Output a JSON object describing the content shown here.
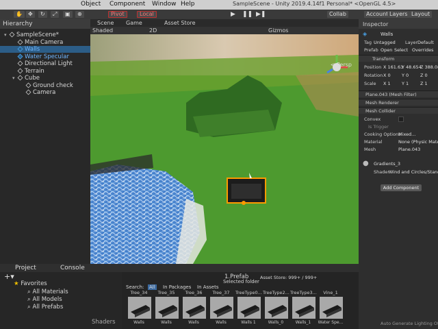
{
  "menu": {
    "items": [
      "Object",
      "Component",
      "Window",
      "Help"
    ],
    "window_title": "SampleScene - Unity 2019.4.14f1 Personal* <OpenGL 4.5>"
  },
  "toolbar": {
    "pivot": "Pivot",
    "local": "Local",
    "collab": "Collab",
    "account": "Account",
    "layers": "Layers",
    "layout": "Layout"
  },
  "hierarchy": {
    "title": "Hierarchy",
    "items": [
      {
        "label": "SampleScene*",
        "depth": 0,
        "selected": false,
        "blue": false
      },
      {
        "label": "Main Camera",
        "depth": 1,
        "selected": false,
        "blue": false
      },
      {
        "label": "Walls",
        "depth": 1,
        "selected": true,
        "blue": true
      },
      {
        "label": "Water Specular",
        "depth": 1,
        "selected": false,
        "blue": true
      },
      {
        "label": "Directional Light",
        "depth": 1,
        "selected": false,
        "blue": false
      },
      {
        "label": "Terrain",
        "depth": 1,
        "selected": false,
        "blue": false
      },
      {
        "label": "Cube",
        "depth": 1,
        "selected": false,
        "blue": false
      },
      {
        "label": "Ground check",
        "depth": 2,
        "selected": false,
        "blue": false
      },
      {
        "label": "Camera",
        "depth": 2,
        "selected": false,
        "blue": false
      }
    ]
  },
  "scene": {
    "tabs": [
      "Scene",
      "Game",
      "Asset Store"
    ],
    "shading": "Shaded",
    "mode": "2D",
    "gizmos": "Gizmos",
    "persp_label": "< Persp"
  },
  "inspector": {
    "title": "Inspector",
    "object_name": "Walls",
    "tag_label": "Tag",
    "tag_value": "Untagged",
    "layer_label": "Layer",
    "layer_value": "Default",
    "prefab_label": "Prefab",
    "prefab_open": "Open",
    "prefab_select": "Select",
    "prefab_overrides": "Overrides",
    "transform": "Transform",
    "position_label": "Position",
    "pos_x": "X 161.63",
    "pos_y": "Y 48.654",
    "pos_z": "Z 388.08",
    "rotation_label": "Rotation",
    "rot_x": "X 0",
    "rot_y": "Y 0",
    "rot_z": "Z 0",
    "scale_label": "Scale",
    "scale_x": "X 1",
    "scale_y": "Y 1",
    "scale_z": "Z 1",
    "mesh_filter": "Plane.043 (Mesh Filter)",
    "mesh_renderer": "Mesh Renderer",
    "mesh_collider": "Mesh Collider",
    "convex": "Convex",
    "is_trigger": "Is Trigger",
    "cooking_label": "Cooking Options",
    "cooking_value": "Mixed...",
    "material_label": "Material",
    "material_value": "None (Physic Mater",
    "mesh_label": "Mesh",
    "mesh_value": "Plane.043",
    "material_name": "Gradients_3",
    "shader_label": "Shader",
    "shader_value": "Wind and Circles/Standar",
    "add_component": "Add Component",
    "footer": "Auto Generate Lighting Off"
  },
  "project": {
    "tabs": [
      "Project",
      "Console"
    ],
    "favorites_title": "Favorites",
    "favorites": [
      "All Materials",
      "All Models",
      "All Prefabs"
    ],
    "shaders": "Shaders",
    "breadcrumb": "1.Prefab",
    "search_label": "Search:",
    "search_scopes": [
      "All",
      "In Packages",
      "In Assets",
      "Selected folder",
      "Asset Store: 999+ / 999+"
    ],
    "assets": [
      {
        "name": "Tree_34",
        "label": "Walls"
      },
      {
        "name": "Tree_35",
        "label": "Walls"
      },
      {
        "name": "Tree_36",
        "label": "Walls"
      },
      {
        "name": "Tree_37",
        "label": "Walls"
      },
      {
        "name": "TreeType0...",
        "label": "Walls 1"
      },
      {
        "name": "TreeType2...",
        "label": "Walls_0"
      },
      {
        "name": "TreeType3...",
        "label": "Walls_1"
      },
      {
        "name": "Vine_1",
        "label": "Water Spe..."
      }
    ]
  },
  "colors": {
    "selection": "#2c5d87",
    "collider_outline": "#ff9a00",
    "ground": "#4a9a2e",
    "water": "#4f86c6"
  }
}
